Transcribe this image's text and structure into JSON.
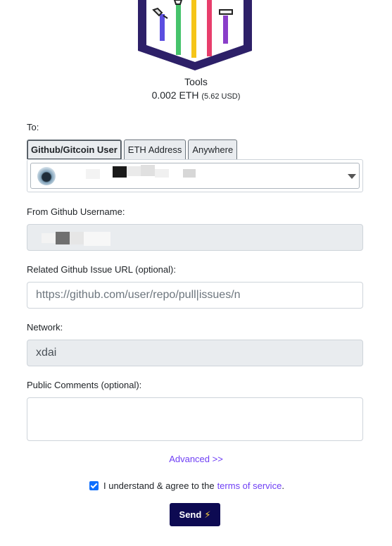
{
  "item": {
    "name": "Tools",
    "amount": "0.002 ETH",
    "usd": "(5.62 USD)"
  },
  "form": {
    "to_label": "To:",
    "tabs": [
      {
        "label": "Github/Gitcoin User",
        "active": true
      },
      {
        "label": "ETH Address",
        "active": false
      },
      {
        "label": "Anywhere",
        "active": false
      }
    ],
    "from_label": "From Github Username:",
    "issue_label": "Related Github Issue URL (optional):",
    "issue_placeholder": "https://github.com/user/repo/pull|issues/n",
    "network_label": "Network:",
    "network_value": "xdai",
    "comments_label": "Public Comments (optional):",
    "advanced_label": "Advanced >>",
    "agree_text": "I understand & agree to the",
    "terms_link": "terms of service",
    "agree_suffix": ".",
    "agree_checked": true,
    "send_label": "Send"
  },
  "colors": {
    "accent": "#6f3ff5",
    "send_button": "#0d0a52",
    "checkbox": "#0d6efd",
    "badge_frame": "#2d2068"
  }
}
